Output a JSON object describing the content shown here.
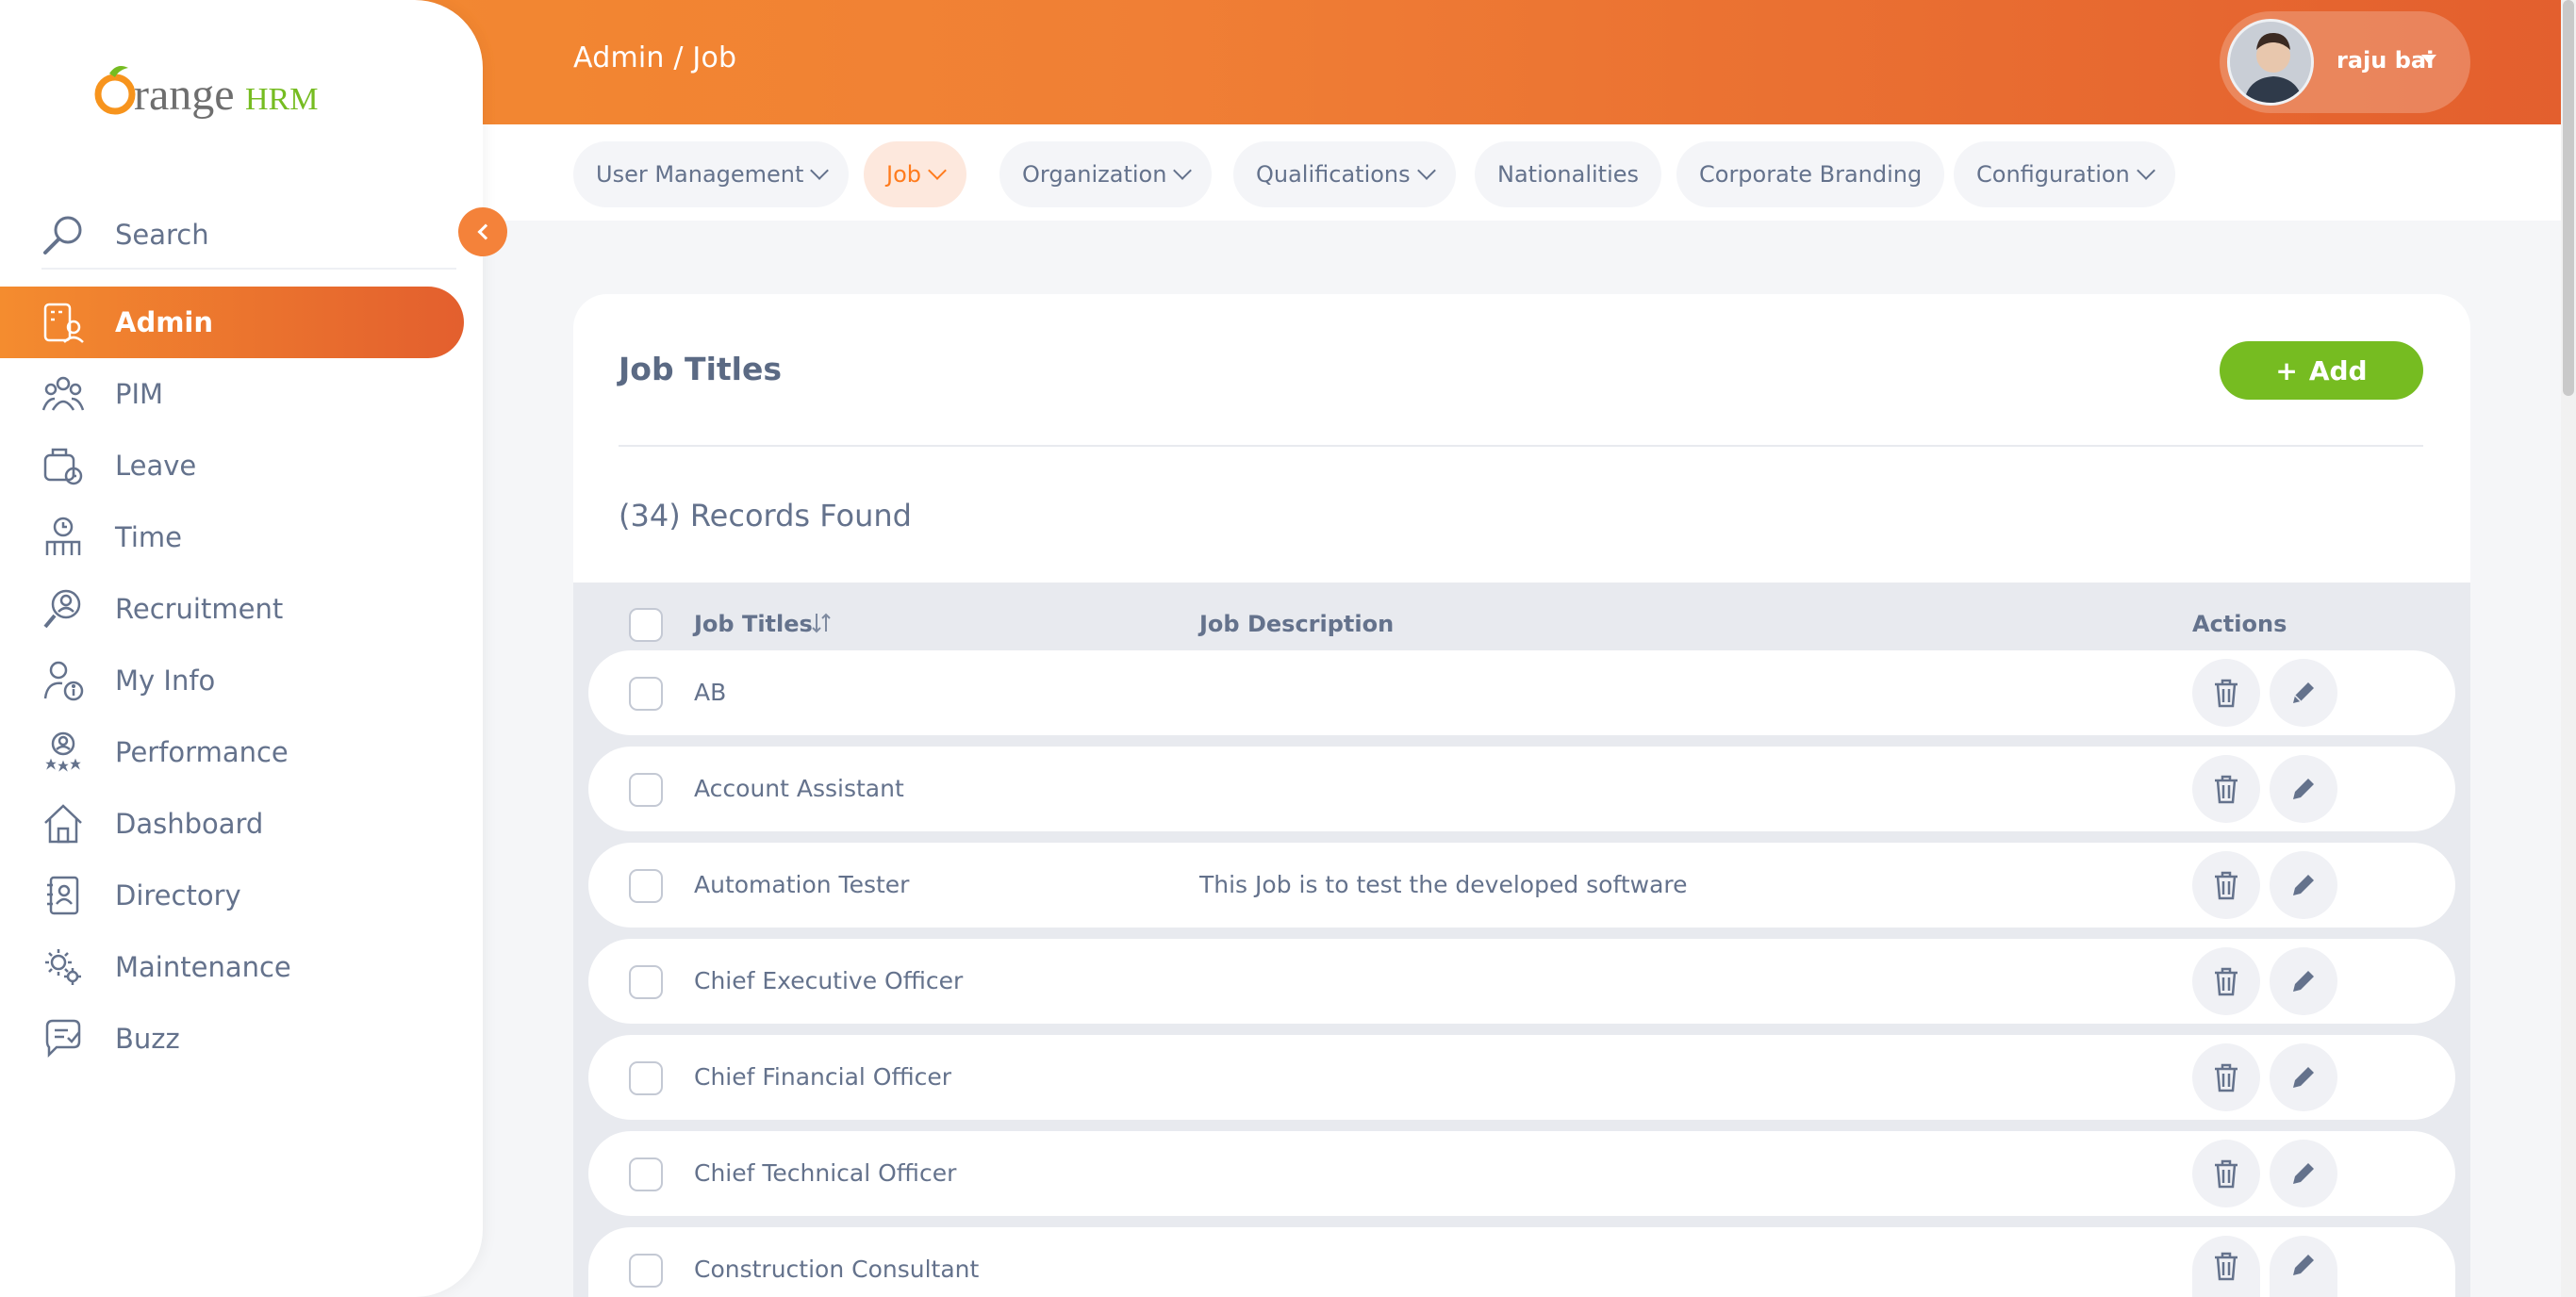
{
  "header": {
    "breadcrumb": "Admin / Job",
    "user_name": "raju bai"
  },
  "subnav": {
    "tabs": [
      {
        "label": "User Management",
        "dropdown": true,
        "active": false
      },
      {
        "label": "Job",
        "dropdown": true,
        "active": true
      },
      {
        "label": "Organization",
        "dropdown": true,
        "active": false
      },
      {
        "label": "Qualifications",
        "dropdown": true,
        "active": false
      },
      {
        "label": "Nationalities",
        "dropdown": false,
        "active": false
      },
      {
        "label": "Corporate Branding",
        "dropdown": false,
        "active": false
      },
      {
        "label": "Configuration",
        "dropdown": true,
        "active": false
      }
    ]
  },
  "sidebar": {
    "logo_text": "OrangeHRM",
    "search_label": "Search",
    "items": [
      {
        "label": "Admin",
        "icon": "admin-icon",
        "active": true
      },
      {
        "label": "PIM",
        "icon": "pim-icon",
        "active": false
      },
      {
        "label": "Leave",
        "icon": "leave-icon",
        "active": false
      },
      {
        "label": "Time",
        "icon": "time-icon",
        "active": false
      },
      {
        "label": "Recruitment",
        "icon": "recruitment-icon",
        "active": false
      },
      {
        "label": "My Info",
        "icon": "my-info-icon",
        "active": false
      },
      {
        "label": "Performance",
        "icon": "performance-icon",
        "active": false
      },
      {
        "label": "Dashboard",
        "icon": "dashboard-icon",
        "active": false
      },
      {
        "label": "Directory",
        "icon": "directory-icon",
        "active": false
      },
      {
        "label": "Maintenance",
        "icon": "maintenance-icon",
        "active": false
      },
      {
        "label": "Buzz",
        "icon": "buzz-icon",
        "active": false
      }
    ]
  },
  "main": {
    "title": "Job Titles",
    "add_label": "Add",
    "records_found": "(34) Records Found",
    "columns": [
      "Job Titles",
      "Job Description",
      "Actions"
    ],
    "rows": [
      {
        "title": "AB",
        "description": ""
      },
      {
        "title": "Account Assistant",
        "description": ""
      },
      {
        "title": "Automation Tester",
        "description": "This Job is to test the developed software"
      },
      {
        "title": "Chief Executive Officer",
        "description": ""
      },
      {
        "title": "Chief Financial Officer",
        "description": ""
      },
      {
        "title": "Chief Technical Officer",
        "description": ""
      },
      {
        "title": "Construction Consultant",
        "description": ""
      }
    ]
  },
  "colors": {
    "brand_orange": "#ff7b1d",
    "add_green": "#76bc21",
    "text": "#64728c"
  }
}
